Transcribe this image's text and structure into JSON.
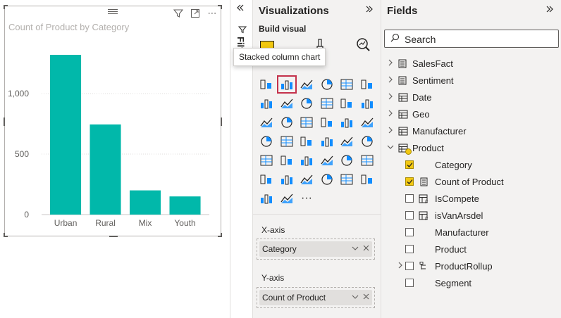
{
  "canvas": {
    "visual": {
      "header_icons": [
        "filter-icon",
        "focus-mode-icon",
        "more-options-icon"
      ],
      "more_label": "⋯"
    }
  },
  "chart_data": {
    "type": "bar",
    "title": "Count of Product by Category",
    "categories": [
      "Urban",
      "Rural",
      "Mix",
      "Youth"
    ],
    "values": [
      1320,
      745,
      200,
      150
    ],
    "ylim": [
      0,
      1500
    ],
    "yticks": [
      0,
      500,
      1000
    ],
    "ytick_labels": [
      "0",
      "500",
      "1,000"
    ],
    "xlabel": "",
    "ylabel": "",
    "grid": true,
    "bar_color": "#01b8aa"
  },
  "filters": {
    "label": "Filters"
  },
  "visualizations": {
    "title": "Visualizations",
    "build_visual_label": "Build visual",
    "tooltip": "Stacked column chart",
    "more_label": "···",
    "x_axis": {
      "label": "X-axis",
      "field": "Category"
    },
    "y_axis": {
      "label": "Y-axis",
      "field": "Count of Product"
    }
  },
  "fields": {
    "title": "Fields",
    "search_placeholder": "Search",
    "tables": [
      {
        "label": "SalesFact",
        "icon": "calculator-table-icon"
      },
      {
        "label": "Sentiment",
        "icon": "calculator-table-icon"
      },
      {
        "label": "Date",
        "icon": "table-icon"
      },
      {
        "label": "Geo",
        "icon": "table-icon"
      },
      {
        "label": "Manufacturer",
        "icon": "table-icon"
      },
      {
        "label": "Product",
        "icon": "table-icon"
      }
    ],
    "product_fields": [
      {
        "label": "Category",
        "checked": true,
        "icon": ""
      },
      {
        "label": "Count of Product",
        "checked": true,
        "icon": "calculator-icon"
      },
      {
        "label": "IsCompete",
        "checked": false,
        "icon": "fx-table-icon"
      },
      {
        "label": "isVanArsdel",
        "checked": false,
        "icon": "fx-table-icon"
      },
      {
        "label": "Manufacturer",
        "checked": false,
        "icon": ""
      },
      {
        "label": "Product",
        "checked": false,
        "icon": ""
      },
      {
        "label": "ProductRollup",
        "checked": false,
        "icon": "hierarchy-icon"
      },
      {
        "label": "Segment",
        "checked": false,
        "icon": ""
      }
    ]
  },
  "colors": {
    "accent_yellow": "#f2c811",
    "selection_red": "#c4314b",
    "pane_bg": "#f3f2f1"
  }
}
